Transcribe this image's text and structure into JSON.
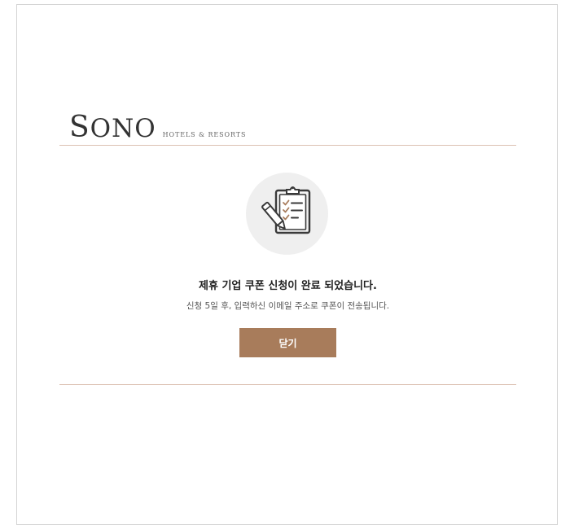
{
  "brand": {
    "name_first": "S",
    "name_rest": "ONO",
    "tagline": "HOTELS & RESORTS"
  },
  "icon": "clipboard-checklist-pen-icon",
  "message": {
    "title": "제휴 기업 쿠폰 신청이 완료 되었습니다.",
    "subtitle": "신청 5일 후, 입력하신 이메일 주소로 쿠폰이 전송됩니다."
  },
  "buttons": {
    "close_label": "닫기"
  },
  "colors": {
    "accent": "#a87c5b",
    "divider": "#dcc1b2",
    "icon_background": "#efefef",
    "icon_check": "#a87c5b"
  }
}
